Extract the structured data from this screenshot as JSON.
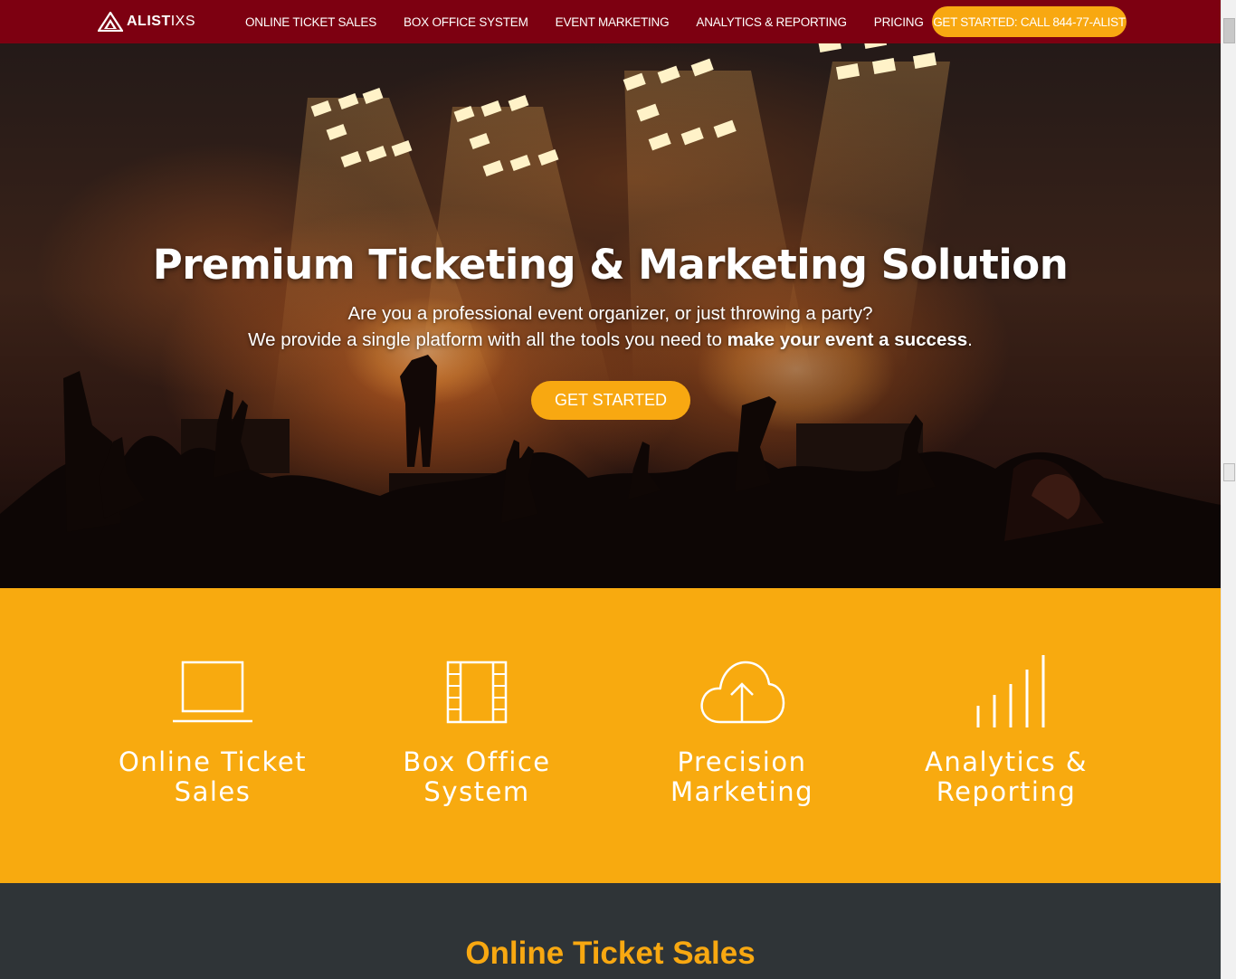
{
  "brand": {
    "logo_bold": "ALIST",
    "logo_thin": "IXS"
  },
  "nav": {
    "items": [
      {
        "label": "ONLINE TICKET SALES"
      },
      {
        "label": "BOX OFFICE SYSTEM"
      },
      {
        "label": "EVENT MARKETING"
      },
      {
        "label": "ANALYTICS & REPORTING"
      },
      {
        "label": "PRICING"
      }
    ],
    "cta_label": "GET STARTED: CALL 844-77-ALIST"
  },
  "hero": {
    "title": "Premium Ticketing & Marketing Solution",
    "subtitle_line1": "Are you a professional event organizer, or just throwing a party?",
    "subtitle_line2_prefix": "We provide a single platform with all the tools you need to ",
    "subtitle_line2_bold": "make your event a success",
    "subtitle_line2_suffix": ".",
    "cta_label": "GET STARTED"
  },
  "features": [
    {
      "icon": "laptop-icon",
      "line1": "Online Ticket",
      "line2": "Sales"
    },
    {
      "icon": "film-strip-icon",
      "line1": "Box Office",
      "line2": "System"
    },
    {
      "icon": "cloud-upload-icon",
      "line1": "Precision",
      "line2": "Marketing"
    },
    {
      "icon": "bar-chart-icon",
      "line1": "Analytics &",
      "line2": "Reporting"
    }
  ],
  "section": {
    "title": "Online Ticket Sales"
  },
  "colors": {
    "nav_bg": "#7d0011",
    "accent": "#f8a811",
    "dark_bg": "#2f3437",
    "text_light": "#ffffff"
  }
}
